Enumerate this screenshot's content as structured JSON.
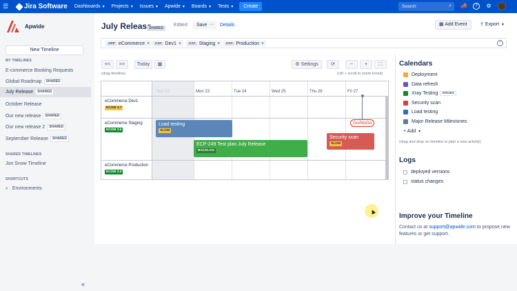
{
  "topnav": {
    "logo": "Jira Software",
    "menu": [
      "Dashboards",
      "Projects",
      "Issues",
      "Apwide",
      "Boards",
      "Tests"
    ],
    "create": "Create",
    "search_placeholder": "Search"
  },
  "sidebar": {
    "brand": "Apwide",
    "new_timeline": "New Timeline",
    "my_title": "MY TIMELINES",
    "my_items": [
      {
        "label": "E-commerce Booking Requests",
        "shared": ""
      },
      {
        "label": "Global Roadmap",
        "shared": "SHARED"
      },
      {
        "label": "July Release",
        "shared": "SHARED"
      },
      {
        "label": "October Release",
        "shared": ""
      },
      {
        "label": "Our new release",
        "shared": "SHARED"
      },
      {
        "label": "Our new release 2",
        "shared": "SHARED"
      },
      {
        "label": "September Release",
        "shared": "SHARED"
      }
    ],
    "shared_title": "SHARED TIMELINES",
    "shared_items": [
      "Jon Snow Timeline"
    ],
    "shortcuts_title": "SHORTCUTS",
    "shortcuts": [
      "Environments"
    ]
  },
  "header": {
    "title": "July Release",
    "badge": "SHARED",
    "edited": "Edited",
    "save": "Save",
    "more": "···",
    "details": "Details",
    "add_event": "Add Event",
    "export": "Export"
  },
  "filters": [
    {
      "key": "APP",
      "value": "eCommerce"
    },
    {
      "key": "CAT",
      "value": "Dev1"
    },
    {
      "key": "CAT",
      "value": "Staging"
    },
    {
      "key": "CAT",
      "value": "Production"
    }
  ],
  "controls": {
    "prev": "<<",
    "next": ">>",
    "today": "Today",
    "settings": "Settings",
    "drag_hint": "(drag timeline)",
    "zoom_hint": "(ctrl + scroll to zoom in/out)"
  },
  "timeline": {
    "days": [
      "Sun 22",
      "Mon 23",
      "Tue 24",
      "Wed 25",
      "Thu 26",
      "Fri 27"
    ],
    "rows": [
      {
        "name": "eCommerce Dev1",
        "badge": "ECOM 3.7",
        "color": "#f6c342"
      },
      {
        "name": "eCommerce Staging",
        "badge": "ECOM 3.6",
        "color": "#14892c"
      },
      {
        "name": "eCommerce Production",
        "badge": "ECOM 2.0",
        "color": "#14892c"
      }
    ],
    "events": [
      {
        "label": "Load testing",
        "tag": "SLOW"
      },
      {
        "label": "ECP-249 Test plan July Release",
        "tag": "BACKLOG"
      },
      {
        "label": "Security scan",
        "tag": "SLOW"
      }
    ],
    "milestone": "Go/NoGo"
  },
  "calendars": {
    "title": "Calendars",
    "items": [
      {
        "label": "Deployment",
        "color": "#f6a935",
        "badge": ""
      },
      {
        "label": "Data refresh",
        "color": "#6554c0",
        "badge": ""
      },
      {
        "label": "Xray Testing",
        "color": "#14892c",
        "badge": "ISSUES"
      },
      {
        "label": "Security scan",
        "color": "#d04437",
        "badge": ""
      },
      {
        "label": "Load testing",
        "color": "#2d6fc4",
        "badge": ""
      },
      {
        "label": "Major Release Milestones",
        "color": "#6b778c",
        "badge": ""
      }
    ],
    "add": "Add",
    "hint": "(drag and drop on timeline to plan a new activity)"
  },
  "logs": {
    "title": "Logs",
    "items": [
      "deployed versions",
      "status changes"
    ]
  },
  "improve": {
    "title": "Improve your Timeline",
    "pre": "Contact us at ",
    "email": "support@apwide.com",
    "post": " to propose new features or get support."
  }
}
